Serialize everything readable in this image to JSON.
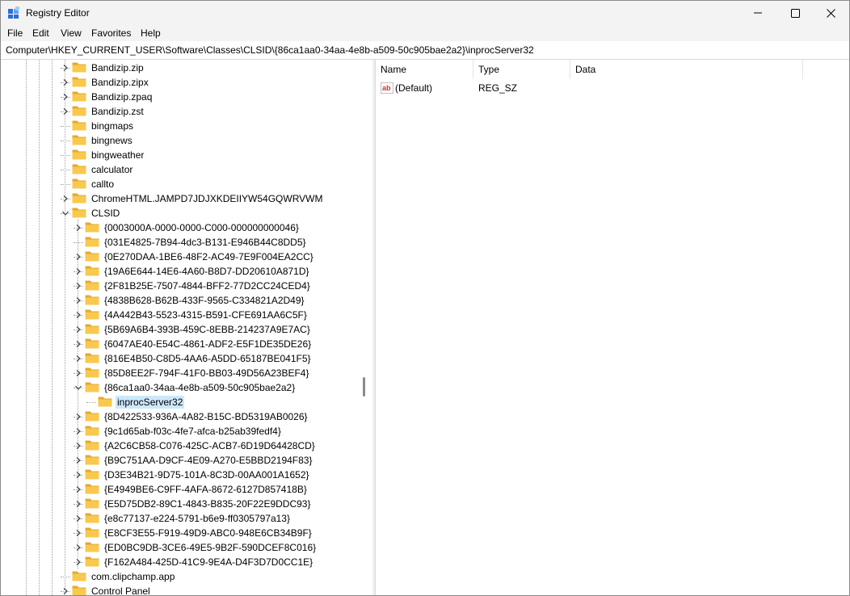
{
  "window": {
    "title": "Registry Editor",
    "controls": [
      "minimize",
      "maximize",
      "close"
    ]
  },
  "menu": [
    "File",
    "Edit",
    "View",
    "Favorites",
    "Help"
  ],
  "address": "Computer\\HKEY_CURRENT_USER\\Software\\Classes\\CLSID\\{86ca1aa0-34aa-4e8b-a509-50c905bae2a2}\\inprocServer32",
  "tree": [
    {
      "label": "Bandizip.zip",
      "level": 0,
      "expander": "right"
    },
    {
      "label": "Bandizip.zipx",
      "level": 0,
      "expander": "right"
    },
    {
      "label": "Bandizip.zpaq",
      "level": 0,
      "expander": "right"
    },
    {
      "label": "Bandizip.zst",
      "level": 0,
      "expander": "right"
    },
    {
      "label": "bingmaps",
      "level": 0,
      "expander": "none"
    },
    {
      "label": "bingnews",
      "level": 0,
      "expander": "none"
    },
    {
      "label": "bingweather",
      "level": 0,
      "expander": "none"
    },
    {
      "label": "calculator",
      "level": 0,
      "expander": "none"
    },
    {
      "label": "callto",
      "level": 0,
      "expander": "none"
    },
    {
      "label": "ChromeHTML.JAMPD7JDJXKDEIIYW54GQWRVWM",
      "level": 0,
      "expander": "right"
    },
    {
      "label": "CLSID",
      "level": 0,
      "expander": "down"
    },
    {
      "label": "{0003000A-0000-0000-C000-000000000046}",
      "level": 1,
      "expander": "right"
    },
    {
      "label": "{031E4825-7B94-4dc3-B131-E946B44C8DD5}",
      "level": 1,
      "expander": "none"
    },
    {
      "label": "{0E270DAA-1BE6-48F2-AC49-7E9F004EA2CC}",
      "level": 1,
      "expander": "right"
    },
    {
      "label": "{19A6E644-14E6-4A60-B8D7-DD20610A871D}",
      "level": 1,
      "expander": "right"
    },
    {
      "label": "{2F81B25E-7507-4844-BFF2-77D2CC24CED4}",
      "level": 1,
      "expander": "right"
    },
    {
      "label": "{4838B628-B62B-433F-9565-C334821A2D49}",
      "level": 1,
      "expander": "right"
    },
    {
      "label": "{4A442B43-5523-4315-B591-CFE691AA6C5F}",
      "level": 1,
      "expander": "right"
    },
    {
      "label": "{5B69A6B4-393B-459C-8EBB-214237A9E7AC}",
      "level": 1,
      "expander": "right"
    },
    {
      "label": "{6047AE40-E54C-4861-ADF2-E5F1DE35DE26}",
      "level": 1,
      "expander": "right"
    },
    {
      "label": "{816E4B50-C8D5-4AA6-A5DD-65187BE041F5}",
      "level": 1,
      "expander": "right"
    },
    {
      "label": "{85D8EE2F-794F-41F0-BB03-49D56A23BEF4}",
      "level": 1,
      "expander": "right"
    },
    {
      "label": "{86ca1aa0-34aa-4e8b-a509-50c905bae2a2}",
      "level": 1,
      "expander": "down"
    },
    {
      "label": "inprocServer32",
      "level": 2,
      "expander": "none",
      "selected": true
    },
    {
      "label": "{8D422533-936A-4A82-B15C-BD5319AB0026}",
      "level": 1,
      "expander": "right"
    },
    {
      "label": "{9c1d65ab-f03c-4fe7-afca-b25ab39fedf4}",
      "level": 1,
      "expander": "right"
    },
    {
      "label": "{A2C6CB58-C076-425C-ACB7-6D19D64428CD}",
      "level": 1,
      "expander": "right"
    },
    {
      "label": "{B9C751AA-D9CF-4E09-A270-E5BBD2194F83}",
      "level": 1,
      "expander": "right"
    },
    {
      "label": "{D3E34B21-9D75-101A-8C3D-00AA001A1652}",
      "level": 1,
      "expander": "right"
    },
    {
      "label": "{E4949BE6-C9FF-4AFA-8672-6127D857418B}",
      "level": 1,
      "expander": "right"
    },
    {
      "label": "{E5D75DB2-89C1-4843-B835-20F22E9DDC93}",
      "level": 1,
      "expander": "right"
    },
    {
      "label": "{e8c77137-e224-5791-b6e9-ff0305797a13}",
      "level": 1,
      "expander": "right"
    },
    {
      "label": "{E8CF3E55-F919-49D9-ABC0-948E6CB34B9F}",
      "level": 1,
      "expander": "right"
    },
    {
      "label": "{ED0BC9DB-3CE6-49E5-9B2F-590DCEF8C016}",
      "level": 1,
      "expander": "right"
    },
    {
      "label": "{F162A484-425D-41C9-9E4A-D4F3D7D0CC1E}",
      "level": 1,
      "expander": "right"
    },
    {
      "label": "com.clipchamp.app",
      "level": 0,
      "expander": "none"
    },
    {
      "label": "Control Panel",
      "level": 0,
      "expander": "right"
    }
  ],
  "list": {
    "columns": [
      "Name",
      "Type",
      "Data"
    ],
    "rows": [
      {
        "name": "(Default)",
        "type": "REG_SZ",
        "data": "",
        "icon": "string-value-icon"
      }
    ]
  },
  "colors": {
    "folder": "#f8c94e",
    "folder_dark": "#e4a92c",
    "selection": "#cce8ff",
    "titlebar": "#f3f3f3"
  }
}
